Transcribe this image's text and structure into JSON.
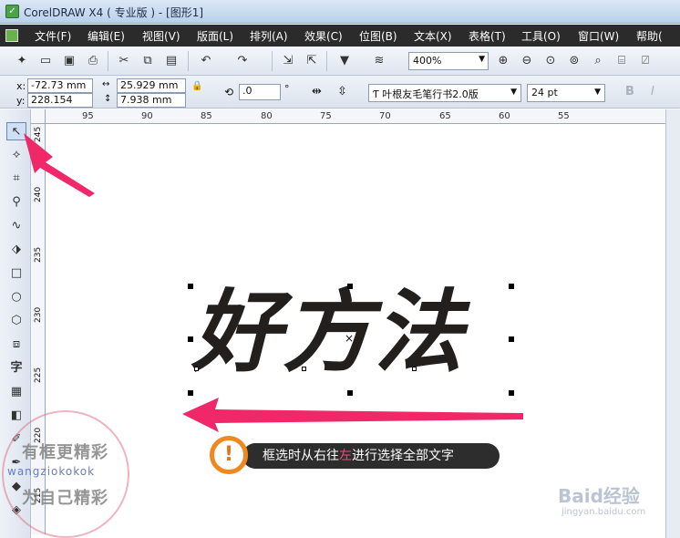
{
  "window": {
    "title": "CorelDRAW X4 ( 专业版 ) - [图形1]"
  },
  "menu": [
    "文件(F)",
    "编辑(E)",
    "视图(V)",
    "版面(L)",
    "排列(A)",
    "效果(C)",
    "位图(B)",
    "文本(X)",
    "表格(T)",
    "工具(O)",
    "窗口(W)",
    "帮助("
  ],
  "toolbar": {
    "zoom": "400%"
  },
  "property_bar": {
    "x_label": "x:",
    "x_value": "-72.73 mm",
    "y_label": "y:",
    "y_value": "228.154 mm",
    "w_value": "25.929 mm",
    "h_value": "7.938 mm",
    "rotation": ".0",
    "degree": "°",
    "font": "叶根友毛笔行书2.0版",
    "size": "24 pt",
    "bold": "B",
    "italic": "I"
  },
  "ruler": {
    "h_ticks": [
      "95",
      "90",
      "85",
      "80",
      "75",
      "70",
      "65",
      "60",
      "55"
    ],
    "v_ticks": [
      "245",
      "240",
      "235",
      "230",
      "225",
      "220",
      "215"
    ]
  },
  "canvas": {
    "text": "好方法"
  },
  "tip": {
    "icon": "!",
    "text_before": "框选时从右往",
    "text_highlight": "左",
    "text_after": "进行选择全部文字"
  },
  "watermark": {
    "line1": "有框更精彩",
    "line2": "wangziokokok",
    "line3": "为自己精彩"
  },
  "baidu": {
    "logo": "Baid经验",
    "sub": "jingyan.baidu.com"
  },
  "colors": {
    "arrow": "#f0286a",
    "tip_ring": "#f0881e",
    "menubar": "#2b2b2b"
  }
}
